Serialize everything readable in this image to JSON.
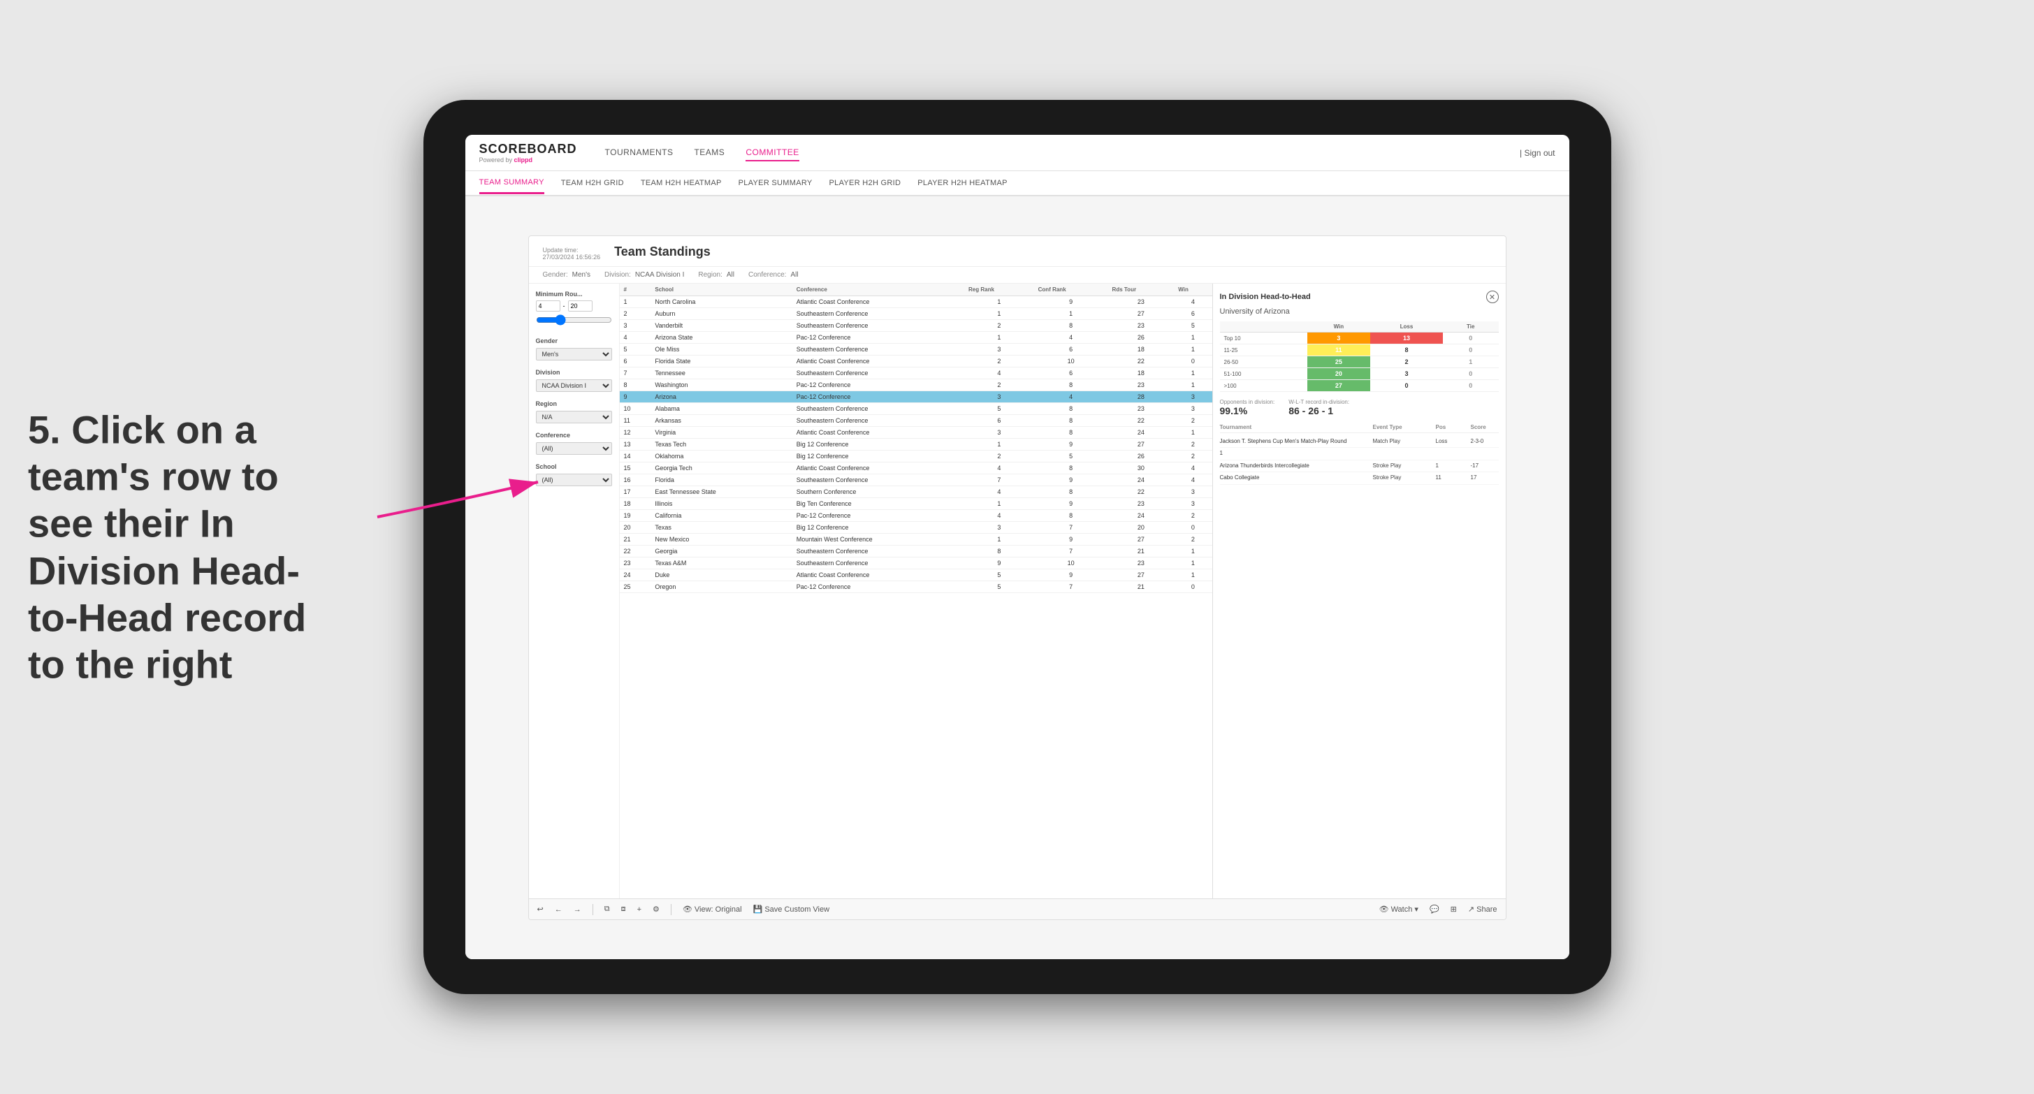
{
  "app": {
    "logo": "SCOREBOARD",
    "powered_by": "Powered by clippd",
    "sign_out": "| Sign out"
  },
  "main_nav": [
    {
      "label": "TOURNAMENTS",
      "active": false
    },
    {
      "label": "TEAMS",
      "active": false
    },
    {
      "label": "COMMITTEE",
      "active": true
    }
  ],
  "sub_nav": [
    {
      "label": "TEAM SUMMARY",
      "active": true
    },
    {
      "label": "TEAM H2H GRID",
      "active": false
    },
    {
      "label": "TEAM H2H HEATMAP",
      "active": false
    },
    {
      "label": "PLAYER SUMMARY",
      "active": false
    },
    {
      "label": "PLAYER H2H GRID",
      "active": false
    },
    {
      "label": "PLAYER H2H HEATMAP",
      "active": false
    }
  ],
  "panel": {
    "title": "Team Standings",
    "update_time": "Update time:",
    "update_date": "27/03/2024 16:56:26",
    "filters": {
      "gender_label": "Gender:",
      "gender_value": "Men's",
      "division_label": "Division:",
      "division_value": "NCAA Division I",
      "region_label": "Region:",
      "region_value": "All",
      "conference_label": "Conference:",
      "conference_value": "All"
    }
  },
  "sidebar": {
    "min_rounds_label": "Minimum Rou...",
    "min_rounds_value": "4",
    "min_rounds_max": "20",
    "gender_label": "Gender",
    "gender_value": "Men's",
    "division_label": "Division",
    "division_value": "NCAA Division I",
    "region_label": "Region",
    "region_value": "N/A",
    "conference_label": "Conference",
    "conference_value": "(All)",
    "school_label": "School",
    "school_value": "(All)"
  },
  "table_headers": [
    "#",
    "School",
    "Conference",
    "Reg Rank",
    "Conf Rank",
    "Rds Tour",
    "Win"
  ],
  "teams": [
    {
      "num": 1,
      "school": "North Carolina",
      "conference": "Atlantic Coast Conference",
      "reg_rank": 1,
      "conf_rank": 9,
      "rds": 23,
      "win": 4
    },
    {
      "num": 2,
      "school": "Auburn",
      "conference": "Southeastern Conference",
      "reg_rank": 1,
      "conf_rank": 1,
      "rds": 27,
      "win": 6
    },
    {
      "num": 3,
      "school": "Vanderbilt",
      "conference": "Southeastern Conference",
      "reg_rank": 2,
      "conf_rank": 8,
      "rds": 23,
      "win": 5
    },
    {
      "num": 4,
      "school": "Arizona State",
      "conference": "Pac-12 Conference",
      "reg_rank": 1,
      "conf_rank": 4,
      "rds": 26,
      "win": 1
    },
    {
      "num": 5,
      "school": "Ole Miss",
      "conference": "Southeastern Conference",
      "reg_rank": 3,
      "conf_rank": 6,
      "rds": 18,
      "win": 1
    },
    {
      "num": 6,
      "school": "Florida State",
      "conference": "Atlantic Coast Conference",
      "reg_rank": 2,
      "conf_rank": 10,
      "rds": 22,
      "win": 0
    },
    {
      "num": 7,
      "school": "Tennessee",
      "conference": "Southeastern Conference",
      "reg_rank": 4,
      "conf_rank": 6,
      "rds": 18,
      "win": 1
    },
    {
      "num": 8,
      "school": "Washington",
      "conference": "Pac-12 Conference",
      "reg_rank": 2,
      "conf_rank": 8,
      "rds": 23,
      "win": 1
    },
    {
      "num": 9,
      "school": "Arizona",
      "conference": "Pac-12 Conference",
      "reg_rank": 3,
      "conf_rank": 4,
      "rds": 28,
      "win": 3,
      "selected": true
    },
    {
      "num": 10,
      "school": "Alabama",
      "conference": "Southeastern Conference",
      "reg_rank": 5,
      "conf_rank": 8,
      "rds": 23,
      "win": 3
    },
    {
      "num": 11,
      "school": "Arkansas",
      "conference": "Southeastern Conference",
      "reg_rank": 6,
      "conf_rank": 8,
      "rds": 22,
      "win": 2
    },
    {
      "num": 12,
      "school": "Virginia",
      "conference": "Atlantic Coast Conference",
      "reg_rank": 3,
      "conf_rank": 8,
      "rds": 24,
      "win": 1
    },
    {
      "num": 13,
      "school": "Texas Tech",
      "conference": "Big 12 Conference",
      "reg_rank": 1,
      "conf_rank": 9,
      "rds": 27,
      "win": 2
    },
    {
      "num": 14,
      "school": "Oklahoma",
      "conference": "Big 12 Conference",
      "reg_rank": 2,
      "conf_rank": 5,
      "rds": 26,
      "win": 2
    },
    {
      "num": 15,
      "school": "Georgia Tech",
      "conference": "Atlantic Coast Conference",
      "reg_rank": 4,
      "conf_rank": 8,
      "rds": 30,
      "win": 4
    },
    {
      "num": 16,
      "school": "Florida",
      "conference": "Southeastern Conference",
      "reg_rank": 7,
      "conf_rank": 9,
      "rds": 24,
      "win": 4
    },
    {
      "num": 17,
      "school": "East Tennessee State",
      "conference": "Southern Conference",
      "reg_rank": 4,
      "conf_rank": 8,
      "rds": 22,
      "win": 3
    },
    {
      "num": 18,
      "school": "Illinois",
      "conference": "Big Ten Conference",
      "reg_rank": 1,
      "conf_rank": 9,
      "rds": 23,
      "win": 3
    },
    {
      "num": 19,
      "school": "California",
      "conference": "Pac-12 Conference",
      "reg_rank": 4,
      "conf_rank": 8,
      "rds": 24,
      "win": 2
    },
    {
      "num": 20,
      "school": "Texas",
      "conference": "Big 12 Conference",
      "reg_rank": 3,
      "conf_rank": 7,
      "rds": 20,
      "win": 0
    },
    {
      "num": 21,
      "school": "New Mexico",
      "conference": "Mountain West Conference",
      "reg_rank": 1,
      "conf_rank": 9,
      "rds": 27,
      "win": 2
    },
    {
      "num": 22,
      "school": "Georgia",
      "conference": "Southeastern Conference",
      "reg_rank": 8,
      "conf_rank": 7,
      "rds": 21,
      "win": 1
    },
    {
      "num": 23,
      "school": "Texas A&M",
      "conference": "Southeastern Conference",
      "reg_rank": 9,
      "conf_rank": 10,
      "rds": 23,
      "win": 1
    },
    {
      "num": 24,
      "school": "Duke",
      "conference": "Atlantic Coast Conference",
      "reg_rank": 5,
      "conf_rank": 9,
      "rds": 27,
      "win": 1
    },
    {
      "num": 25,
      "school": "Oregon",
      "conference": "Pac-12 Conference",
      "reg_rank": 5,
      "conf_rank": 7,
      "rds": 21,
      "win": 0
    }
  ],
  "h2h": {
    "title": "In Division Head-to-Head",
    "team_name": "University of Arizona",
    "headers": [
      "",
      "Win",
      "Loss",
      "Tie"
    ],
    "rows": [
      {
        "range": "Top 10",
        "win": 3,
        "loss": 13,
        "tie": 0,
        "win_color": "orange",
        "loss_color": "red"
      },
      {
        "range": "11-25",
        "win": 11,
        "loss": 8,
        "tie": 0,
        "win_color": "yellow",
        "loss_color": "none"
      },
      {
        "range": "26-50",
        "win": 25,
        "loss": 2,
        "tie": 1,
        "win_color": "green",
        "loss_color": "none"
      },
      {
        "range": "51-100",
        "win": 20,
        "loss": 3,
        "tie": 0,
        "win_color": "green",
        "loss_color": "none"
      },
      {
        "range": ">100",
        "win": 27,
        "loss": 0,
        "tie": 0,
        "win_color": "green",
        "loss_color": "none"
      }
    ],
    "opponents_label": "Opponents in division:",
    "opponents_value": "99.1%",
    "wlt_label": "W-L-T record in-division:",
    "wlt_value": "86 - 26 - 1",
    "tournament_headers": [
      "Tournament",
      "Event Type",
      "Pos",
      "Score"
    ],
    "tournaments": [
      {
        "name": "Jackson T. Stephens Cup Men's Match-Play Round",
        "event_type": "Match Play",
        "pos": "Loss",
        "score": "2-3-0"
      },
      {
        "name": "1",
        "event_type": "",
        "pos": "",
        "score": ""
      },
      {
        "name": "Arizona Thunderbirds Intercollegiate",
        "event_type": "Stroke Play",
        "pos": "1",
        "score": "-17"
      },
      {
        "name": "Cabo Collegiate",
        "event_type": "Stroke Play",
        "pos": "11",
        "score": "17"
      }
    ]
  },
  "toolbar": {
    "undo": "↩",
    "redo_left": "←",
    "redo_right": "→",
    "copy": "⧉",
    "paste": "⧈",
    "settings": "⚙",
    "view_original": "View: Original",
    "save_custom": "Save Custom View",
    "watch": "Watch",
    "comment": "💬",
    "share": "Share"
  },
  "annotation": {
    "text": "5. Click on a team's row to see their In Division Head-to-Head record to the right"
  }
}
